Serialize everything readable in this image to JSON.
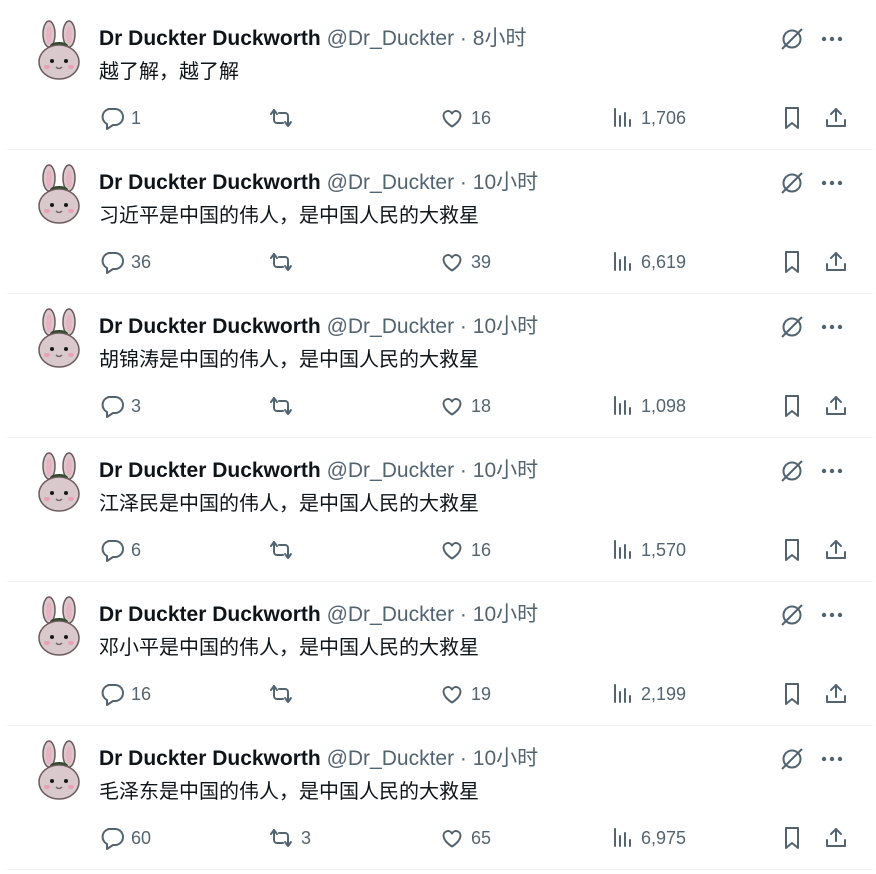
{
  "colors": {
    "text": "#0f1419",
    "secondary": "#536471",
    "divider": "#eff3f4",
    "avatar_ear": "#e8b4c4",
    "avatar_face": "#d9c9cc"
  },
  "icons": {
    "reply": "reply-icon",
    "retweet": "retweet-icon",
    "like": "heart-icon",
    "views": "views-icon",
    "bookmark": "bookmark-icon",
    "share": "share-icon",
    "grok": "grok-icon",
    "more": "more-icon"
  },
  "tweets": [
    {
      "name": "Dr Duckter Duckworth",
      "handle": "@Dr_Duckter",
      "dot": "·",
      "time": "8小时",
      "text": "越了解，越了解",
      "replies": "1",
      "retweets": "",
      "likes": "16",
      "views": "1,706"
    },
    {
      "name": "Dr Duckter Duckworth",
      "handle": "@Dr_Duckter",
      "dot": "·",
      "time": "10小时",
      "text": "习近平是中国的伟人，是中国人民的大救星",
      "replies": "36",
      "retweets": "",
      "likes": "39",
      "views": "6,619"
    },
    {
      "name": "Dr Duckter Duckworth",
      "handle": "@Dr_Duckter",
      "dot": "·",
      "time": "10小时",
      "text": "胡锦涛是中国的伟人，是中国人民的大救星",
      "replies": "3",
      "retweets": "",
      "likes": "18",
      "views": "1,098"
    },
    {
      "name": "Dr Duckter Duckworth",
      "handle": "@Dr_Duckter",
      "dot": "·",
      "time": "10小时",
      "text": "江泽民是中国的伟人，是中国人民的大救星",
      "replies": "6",
      "retweets": "",
      "likes": "16",
      "views": "1,570"
    },
    {
      "name": "Dr Duckter Duckworth",
      "handle": "@Dr_Duckter",
      "dot": "·",
      "time": "10小时",
      "text": "邓小平是中国的伟人，是中国人民的大救星",
      "replies": "16",
      "retweets": "",
      "likes": "19",
      "views": "2,199"
    },
    {
      "name": "Dr Duckter Duckworth",
      "handle": "@Dr_Duckter",
      "dot": "·",
      "time": "10小时",
      "text": "毛泽东是中国的伟人，是中国人民的大救星",
      "replies": "60",
      "retweets": "3",
      "likes": "65",
      "views": "6,975"
    }
  ]
}
